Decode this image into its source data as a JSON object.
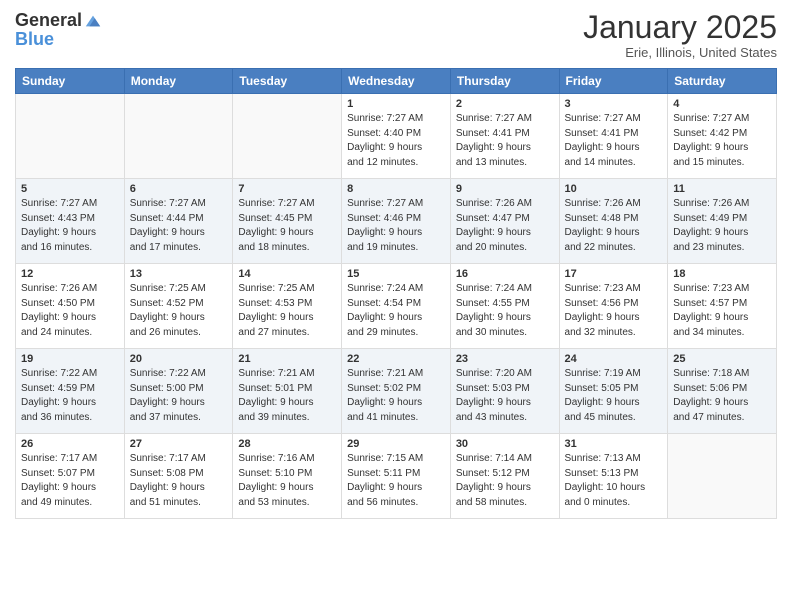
{
  "header": {
    "logo_general": "General",
    "logo_blue": "Blue",
    "month_title": "January 2025",
    "location": "Erie, Illinois, United States"
  },
  "days_of_week": [
    "Sunday",
    "Monday",
    "Tuesday",
    "Wednesday",
    "Thursday",
    "Friday",
    "Saturday"
  ],
  "weeks": [
    [
      {
        "num": "",
        "info": ""
      },
      {
        "num": "",
        "info": ""
      },
      {
        "num": "",
        "info": ""
      },
      {
        "num": "1",
        "info": "Sunrise: 7:27 AM\nSunset: 4:40 PM\nDaylight: 9 hours\nand 12 minutes."
      },
      {
        "num": "2",
        "info": "Sunrise: 7:27 AM\nSunset: 4:41 PM\nDaylight: 9 hours\nand 13 minutes."
      },
      {
        "num": "3",
        "info": "Sunrise: 7:27 AM\nSunset: 4:41 PM\nDaylight: 9 hours\nand 14 minutes."
      },
      {
        "num": "4",
        "info": "Sunrise: 7:27 AM\nSunset: 4:42 PM\nDaylight: 9 hours\nand 15 minutes."
      }
    ],
    [
      {
        "num": "5",
        "info": "Sunrise: 7:27 AM\nSunset: 4:43 PM\nDaylight: 9 hours\nand 16 minutes."
      },
      {
        "num": "6",
        "info": "Sunrise: 7:27 AM\nSunset: 4:44 PM\nDaylight: 9 hours\nand 17 minutes."
      },
      {
        "num": "7",
        "info": "Sunrise: 7:27 AM\nSunset: 4:45 PM\nDaylight: 9 hours\nand 18 minutes."
      },
      {
        "num": "8",
        "info": "Sunrise: 7:27 AM\nSunset: 4:46 PM\nDaylight: 9 hours\nand 19 minutes."
      },
      {
        "num": "9",
        "info": "Sunrise: 7:26 AM\nSunset: 4:47 PM\nDaylight: 9 hours\nand 20 minutes."
      },
      {
        "num": "10",
        "info": "Sunrise: 7:26 AM\nSunset: 4:48 PM\nDaylight: 9 hours\nand 22 minutes."
      },
      {
        "num": "11",
        "info": "Sunrise: 7:26 AM\nSunset: 4:49 PM\nDaylight: 9 hours\nand 23 minutes."
      }
    ],
    [
      {
        "num": "12",
        "info": "Sunrise: 7:26 AM\nSunset: 4:50 PM\nDaylight: 9 hours\nand 24 minutes."
      },
      {
        "num": "13",
        "info": "Sunrise: 7:25 AM\nSunset: 4:52 PM\nDaylight: 9 hours\nand 26 minutes."
      },
      {
        "num": "14",
        "info": "Sunrise: 7:25 AM\nSunset: 4:53 PM\nDaylight: 9 hours\nand 27 minutes."
      },
      {
        "num": "15",
        "info": "Sunrise: 7:24 AM\nSunset: 4:54 PM\nDaylight: 9 hours\nand 29 minutes."
      },
      {
        "num": "16",
        "info": "Sunrise: 7:24 AM\nSunset: 4:55 PM\nDaylight: 9 hours\nand 30 minutes."
      },
      {
        "num": "17",
        "info": "Sunrise: 7:23 AM\nSunset: 4:56 PM\nDaylight: 9 hours\nand 32 minutes."
      },
      {
        "num": "18",
        "info": "Sunrise: 7:23 AM\nSunset: 4:57 PM\nDaylight: 9 hours\nand 34 minutes."
      }
    ],
    [
      {
        "num": "19",
        "info": "Sunrise: 7:22 AM\nSunset: 4:59 PM\nDaylight: 9 hours\nand 36 minutes."
      },
      {
        "num": "20",
        "info": "Sunrise: 7:22 AM\nSunset: 5:00 PM\nDaylight: 9 hours\nand 37 minutes."
      },
      {
        "num": "21",
        "info": "Sunrise: 7:21 AM\nSunset: 5:01 PM\nDaylight: 9 hours\nand 39 minutes."
      },
      {
        "num": "22",
        "info": "Sunrise: 7:21 AM\nSunset: 5:02 PM\nDaylight: 9 hours\nand 41 minutes."
      },
      {
        "num": "23",
        "info": "Sunrise: 7:20 AM\nSunset: 5:03 PM\nDaylight: 9 hours\nand 43 minutes."
      },
      {
        "num": "24",
        "info": "Sunrise: 7:19 AM\nSunset: 5:05 PM\nDaylight: 9 hours\nand 45 minutes."
      },
      {
        "num": "25",
        "info": "Sunrise: 7:18 AM\nSunset: 5:06 PM\nDaylight: 9 hours\nand 47 minutes."
      }
    ],
    [
      {
        "num": "26",
        "info": "Sunrise: 7:17 AM\nSunset: 5:07 PM\nDaylight: 9 hours\nand 49 minutes."
      },
      {
        "num": "27",
        "info": "Sunrise: 7:17 AM\nSunset: 5:08 PM\nDaylight: 9 hours\nand 51 minutes."
      },
      {
        "num": "28",
        "info": "Sunrise: 7:16 AM\nSunset: 5:10 PM\nDaylight: 9 hours\nand 53 minutes."
      },
      {
        "num": "29",
        "info": "Sunrise: 7:15 AM\nSunset: 5:11 PM\nDaylight: 9 hours\nand 56 minutes."
      },
      {
        "num": "30",
        "info": "Sunrise: 7:14 AM\nSunset: 5:12 PM\nDaylight: 9 hours\nand 58 minutes."
      },
      {
        "num": "31",
        "info": "Sunrise: 7:13 AM\nSunset: 5:13 PM\nDaylight: 10 hours\nand 0 minutes."
      },
      {
        "num": "",
        "info": ""
      }
    ]
  ]
}
